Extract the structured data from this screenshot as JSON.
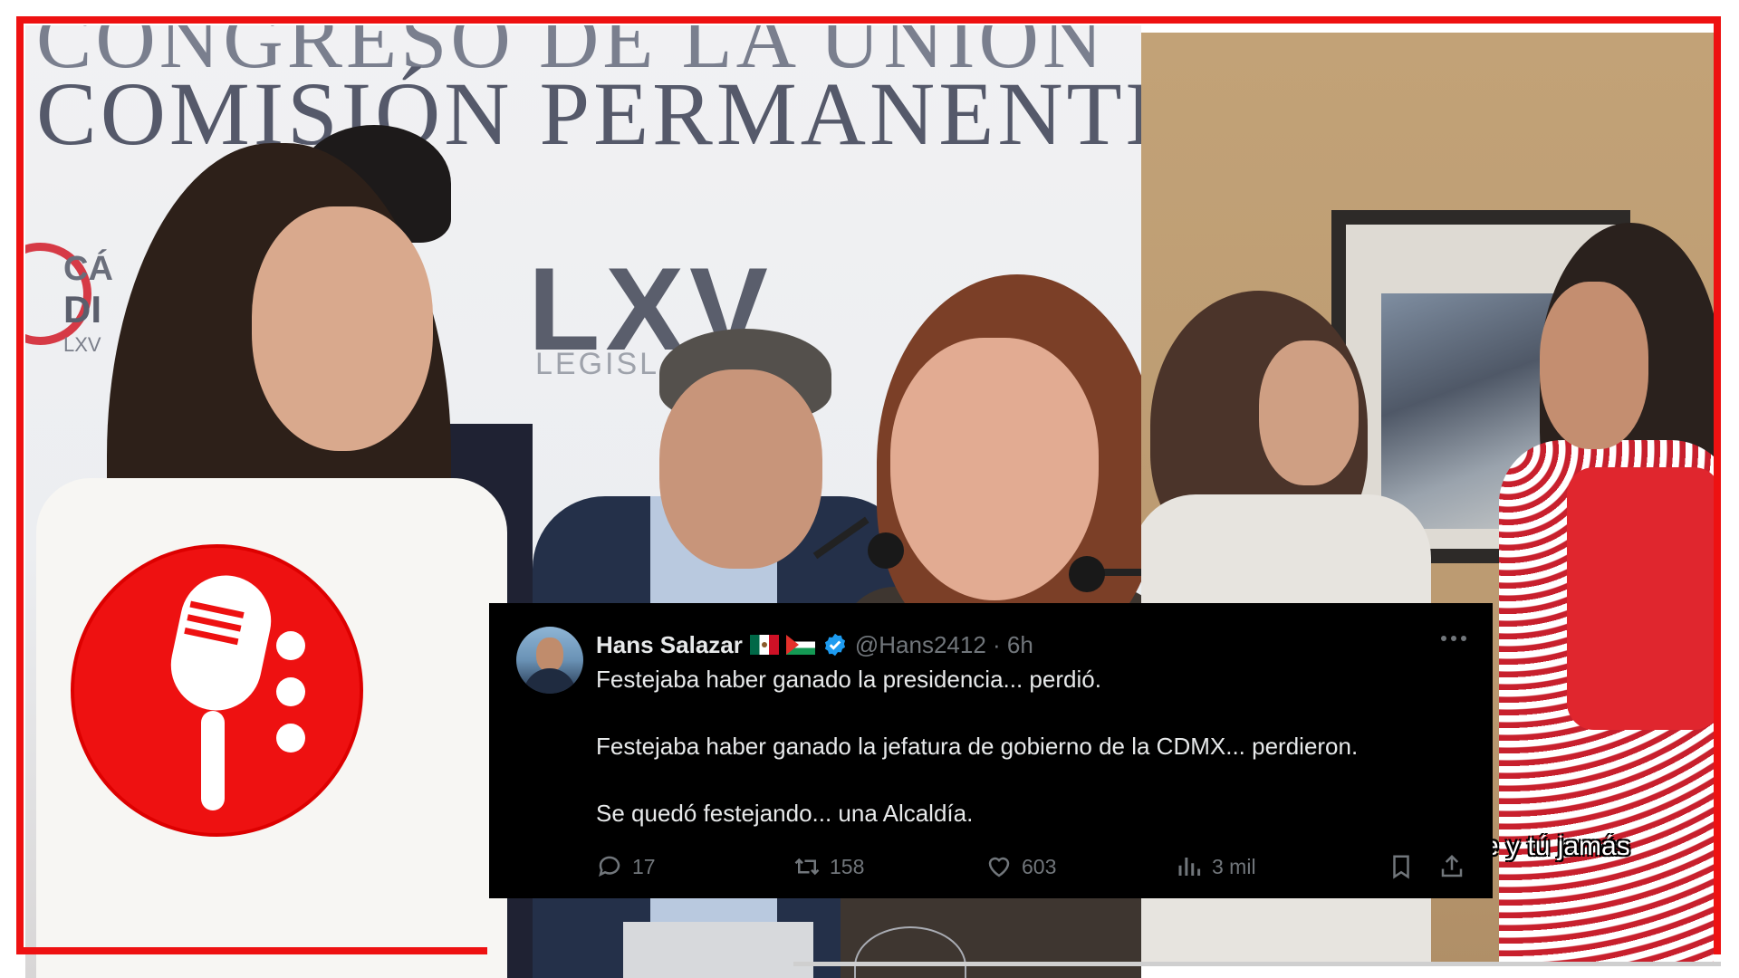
{
  "left_photo": {
    "banner_line_1": "CONGRESO DE LA UNIÓN",
    "banner_line_2": "COMISIÓN PERMANENTE",
    "logo_text": "LXV",
    "logo_subtext": "LEGISL",
    "side_logo_1": "CÁ",
    "side_logo_2": "DI",
    "side_logo_3": "LXV"
  },
  "right_photo": {
    "subtitle": "e y tú jamás"
  },
  "podcast_logo": {
    "accent_color": "#ee1111",
    "icon": "microphone-icon"
  },
  "tweet": {
    "author_name": "Hans Salazar",
    "flags": [
      "mexico-flag-icon",
      "palestine-flag-icon"
    ],
    "verified_icon": "verified-badge-icon",
    "handle_time": "@Hans2412 · 6h",
    "more_icon": "more-options-icon",
    "lines": [
      "Festejaba haber ganado la presidencia... perdió.",
      "Festejaba haber ganado la jefatura de gobierno de la CDMX... perdieron.",
      "Se quedó festejando... una Alcaldía."
    ],
    "actions": {
      "replies": "17",
      "retweets": "158",
      "likes": "603",
      "views": "3 mil"
    },
    "colors": {
      "background": "#000000",
      "text": "#e7e9ea",
      "muted": "#71767b",
      "verified": "#1d9bf0"
    }
  }
}
